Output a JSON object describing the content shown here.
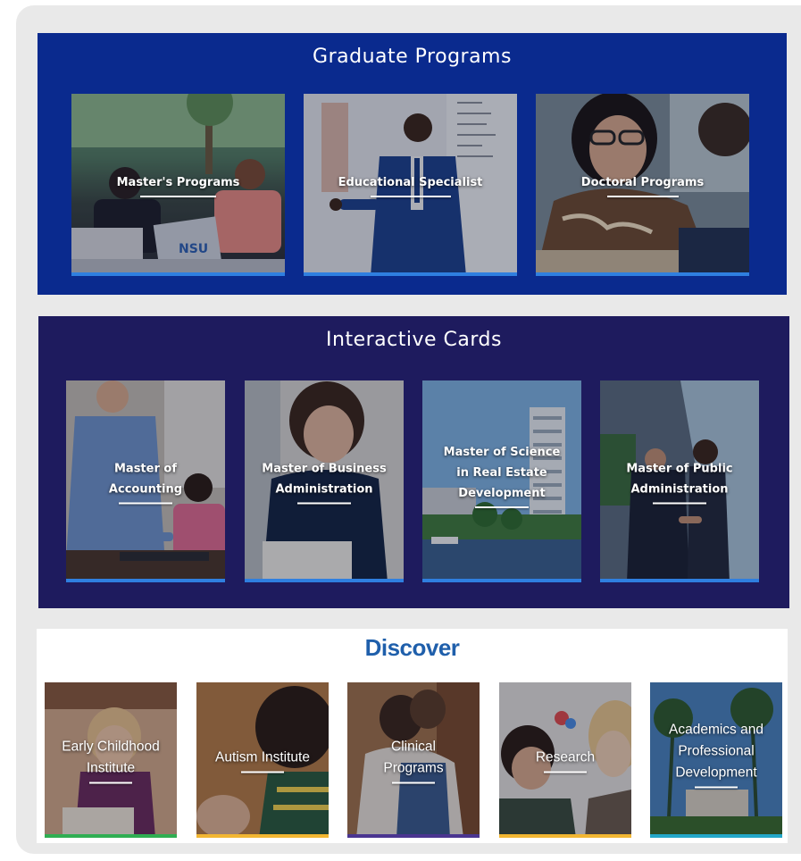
{
  "graduate_programs": {
    "title": "Graduate Programs",
    "cards": [
      {
        "label": "Master's Programs"
      },
      {
        "label": "Educational Specialist"
      },
      {
        "label": "Doctoral Programs"
      }
    ]
  },
  "interactive_cards": {
    "title": "Interactive Cards",
    "cards": [
      {
        "label_line1": "Master of",
        "label_line2": "Accounting"
      },
      {
        "label_line1": "Master of Business",
        "label_line2": "Administration"
      },
      {
        "label_line1": "Master of Science",
        "label_line2": "in Real Estate",
        "label_line3": "Development"
      },
      {
        "label_line1": "Master of Public",
        "label_line2": "Administration"
      }
    ]
  },
  "discover": {
    "title": "Discover",
    "cards": [
      {
        "label_line1": "Early Childhood",
        "label_line2": "Institute"
      },
      {
        "label_line1": "Autism Institute"
      },
      {
        "label_line1": "Clinical",
        "label_line2": "Programs"
      },
      {
        "label_line1": "Research"
      },
      {
        "label_line1": "Academics and",
        "label_line2": "Professional",
        "label_line3": "Development"
      }
    ]
  },
  "colors": {
    "graduate_bg": "#0a2a8e",
    "interactive_bg": "#1e1b5e",
    "discover_title": "#1f5fab",
    "card_accent_blue": "#2f7fe0",
    "discover_bars": [
      "#2fae52",
      "#f2b632",
      "#4a3590",
      "#f2b632",
      "#23a7c8"
    ]
  }
}
